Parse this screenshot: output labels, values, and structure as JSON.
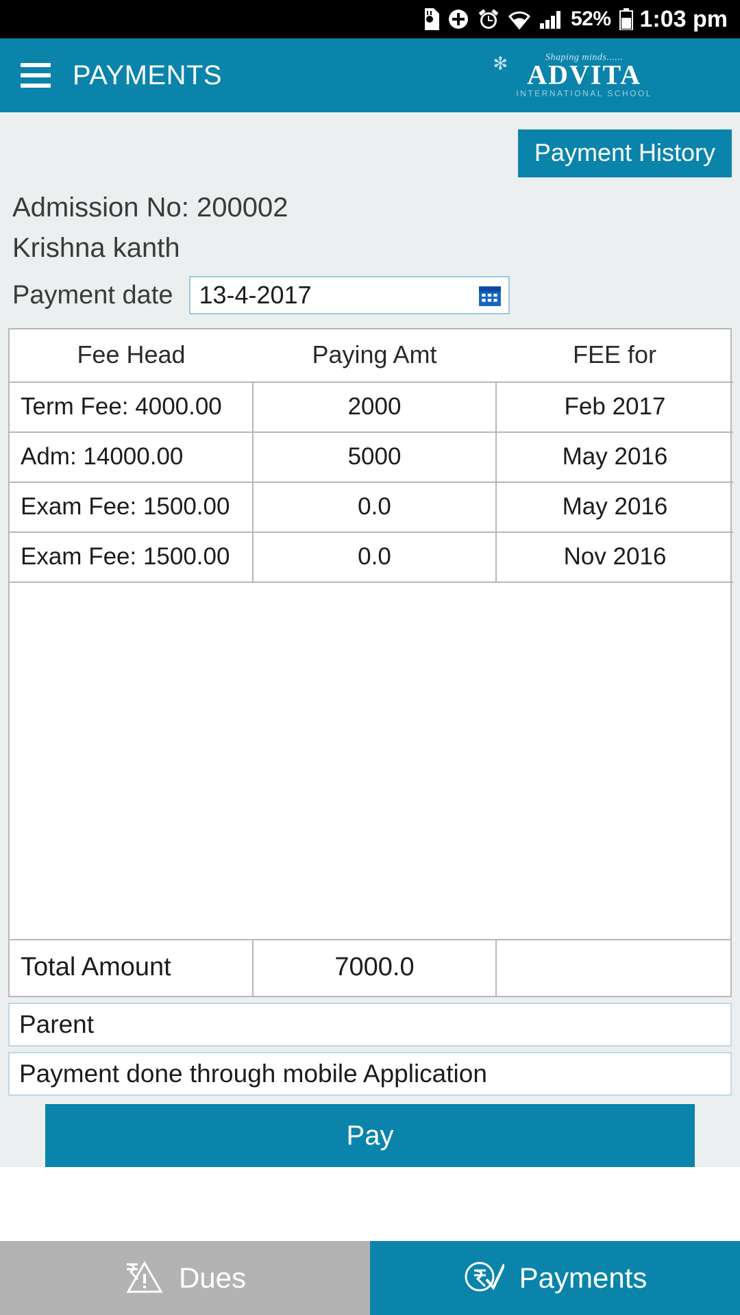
{
  "status_bar": {
    "battery_percent": "52%",
    "time": "1:03 pm",
    "icons": [
      "sd-card-icon",
      "plus-circle-icon",
      "alarm-icon",
      "wifi-icon",
      "signal-icon",
      "battery-icon"
    ]
  },
  "app_bar": {
    "menu_icon": "hamburger-menu-icon",
    "title": "PAYMENTS",
    "logo": {
      "tagline": "Shaping minds......",
      "name": "ADVITA",
      "subtitle": "INTERNATIONAL SCHOOL"
    }
  },
  "header": {
    "payment_history_button": "Payment History",
    "admission_line": "Admission No: 200002",
    "student_name": "Krishna kanth",
    "payment_date_label": "Payment date",
    "payment_date_value": "13-4-2017",
    "calendar_icon": "calendar-icon"
  },
  "fee_table": {
    "columns": [
      "Fee Head",
      "Paying Amt",
      "FEE for"
    ],
    "rows": [
      {
        "fee_head": "Term Fee: 4000.00",
        "paying_amt": "2000",
        "fee_for": "Feb 2017",
        "muted": false
      },
      {
        "fee_head": "Adm: 14000.00",
        "paying_amt": "5000",
        "fee_for": "May 2016",
        "muted": false
      },
      {
        "fee_head": "Exam Fee: 1500.00",
        "paying_amt": "0.0",
        "fee_for": "May 2016",
        "muted": true
      },
      {
        "fee_head": "Exam Fee: 1500.00",
        "paying_amt": "0.0",
        "fee_for": "Nov 2016",
        "muted": true
      }
    ],
    "total_label": "Total Amount",
    "total_value": "7000.0",
    "total_third": ""
  },
  "form": {
    "payer_field": "Parent",
    "remarks_field": "Payment done through mobile Application",
    "pay_button": "Pay"
  },
  "bottom_nav": {
    "items": [
      {
        "label": "Dues",
        "icon": "rupee-warning-icon",
        "active": false
      },
      {
        "label": "Payments",
        "icon": "rupee-check-icon",
        "active": true
      }
    ]
  },
  "colors": {
    "accent": "#0b84ab",
    "status_bar_bg": "#000000",
    "content_bg": "#eceff0",
    "inactive_nav": "#b3b3b3"
  }
}
